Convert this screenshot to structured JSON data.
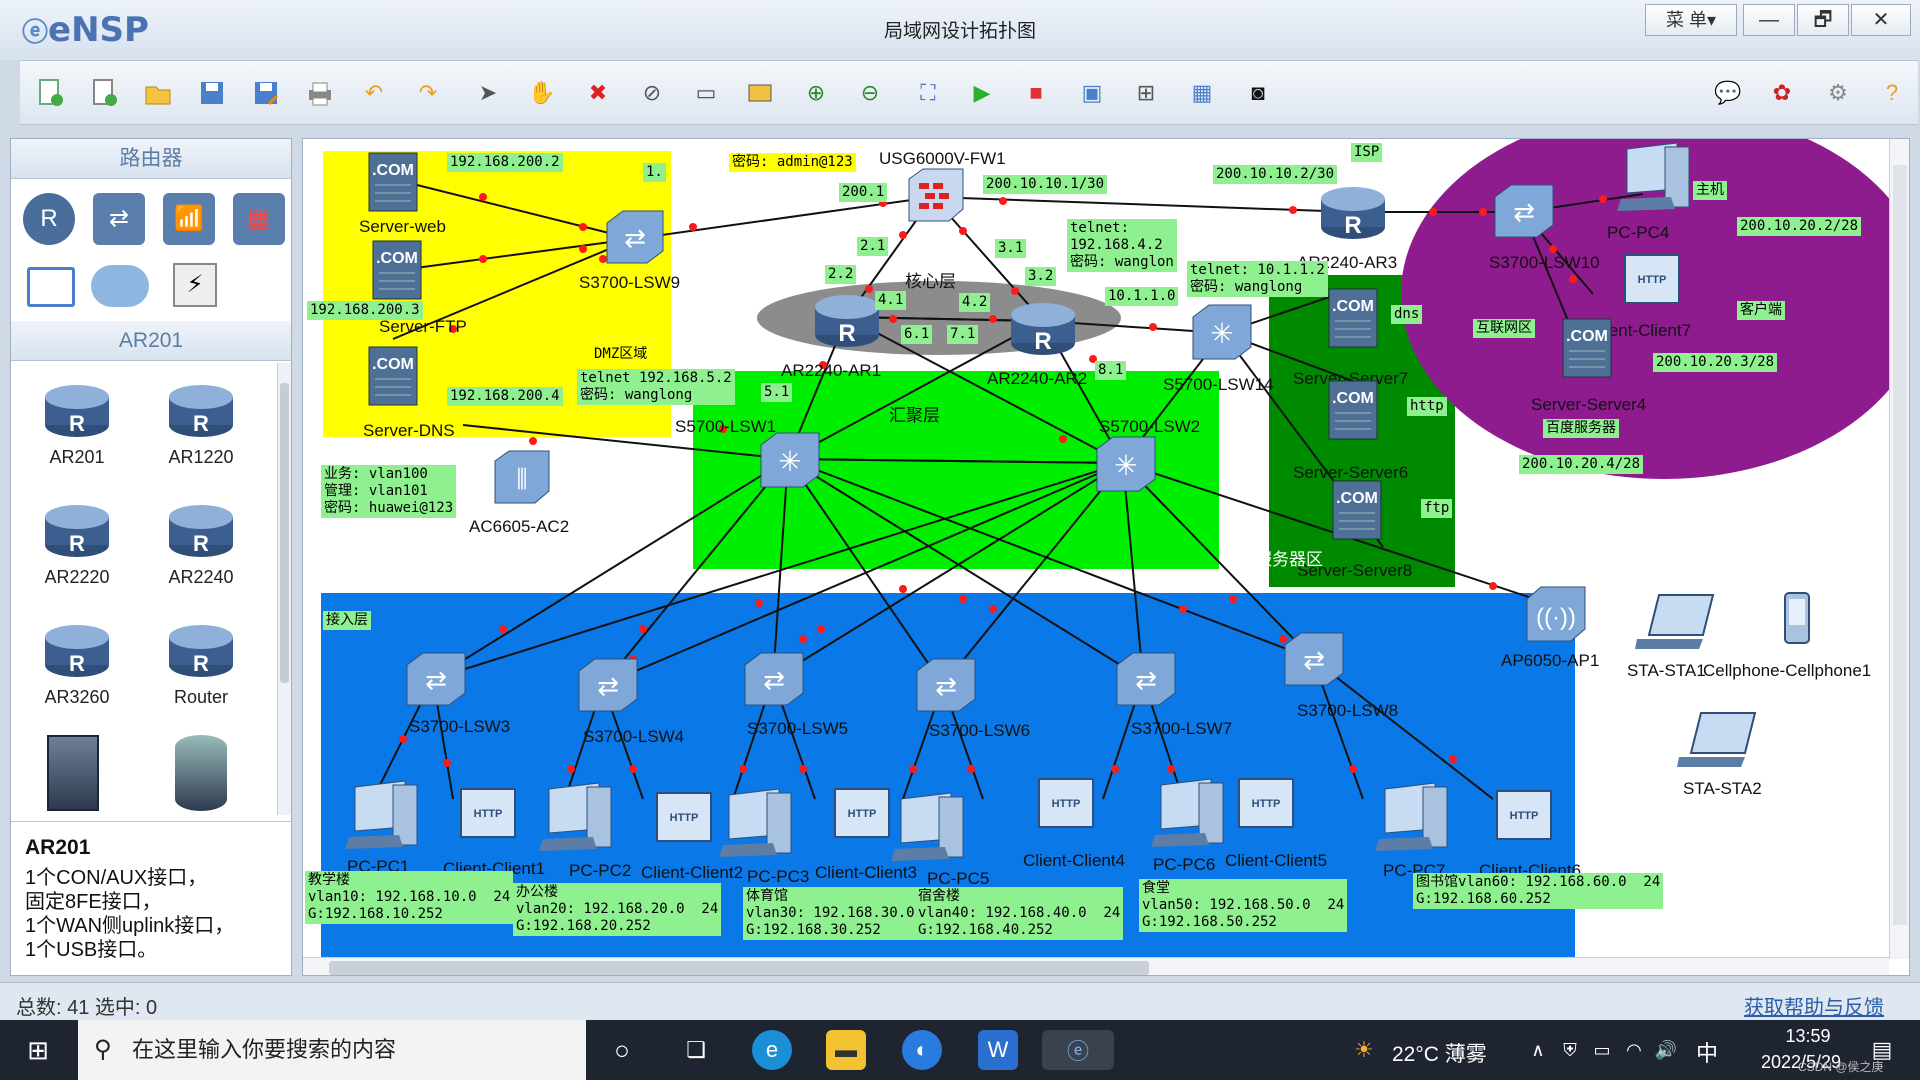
{
  "app": {
    "logo": "eNSP",
    "window_title": "局域网设计拓扑图",
    "menu_label": "菜 单▾",
    "minimize": "—",
    "restore": "🗗",
    "close": "✕"
  },
  "toolbar": {
    "icons": [
      "new-topo-icon",
      "new-sheet-icon",
      "open-icon",
      "save-icon",
      "save-as-icon",
      "print-icon",
      "undo-icon",
      "redo-icon",
      "select-icon",
      "pan-icon",
      "delete-icon",
      "delete-link-icon",
      "text-icon",
      "rect-icon",
      "zoom-in-icon",
      "zoom-out-icon",
      "fit-icon",
      "start-icon",
      "stop-icon",
      "capture-icon",
      "topo-icon",
      "grid-icon",
      "console-icon",
      "chat-icon",
      "huawei-icon",
      "settings-icon",
      "help-icon"
    ]
  },
  "left_panel": {
    "section1": "路由器",
    "section2": "AR201",
    "devices": [
      "AR201",
      "AR1220",
      "AR2220",
      "AR2240",
      "AR3260",
      "Router"
    ],
    "desc_title": "AR201",
    "desc_lines": [
      "1个CON/AUX接口，",
      "固定8FE接口，",
      "1个WAN侧uplink接口，",
      "1个USB接口。"
    ]
  },
  "topology": {
    "zones": {
      "dmz": "DMZ区域",
      "core": "核心层",
      "agg": "汇聚层",
      "server": "服务器区",
      "internet": "互联网区",
      "access": "接入层",
      "isp": "ISP"
    },
    "nodes": {
      "server_web": "Server-web",
      "server_ftp": "Server-FTP",
      "server_dns": "Server-DNS",
      "lsw9": "S3700-LSW9",
      "fw1": "USG6000V-FW1",
      "ar1": "AR2240-AR1",
      "ar2": "AR2240-AR2",
      "ar3": "AR2240-AR3",
      "lsw14": "S5700-LSW14",
      "lsw1": "S5700-LSW1",
      "lsw2": "S5700-LSW2",
      "lsw10": "S3700-LSW10",
      "pc4": "PC-PC4",
      "client7": "Client-Client7",
      "server4": "Server-Server4",
      "server7": "Server-Server7",
      "server6": "Server-Server6",
      "server8": "Server-Server8",
      "ac2": "AC6605-AC2",
      "ap1": "AP6050-AP1",
      "sta1": "STA-STA1",
      "cell1": "Cellphone-Cellphone1",
      "sta2": "STA-STA2",
      "lsw3": "S3700-LSW3",
      "lsw4": "S3700-LSW4",
      "lsw5": "S3700-LSW5",
      "lsw6": "S3700-LSW6",
      "lsw7": "S3700-LSW7",
      "lsw8": "S3700-LSW8",
      "pc1": "PC-PC1",
      "client1": "Client-Client1",
      "pc2": "PC-PC2",
      "client2": "Client-Client2",
      "pc3": "PC-PC3",
      "client3": "Client-Client3",
      "pc5": "PC-PC5",
      "client4": "Client-Client4",
      "pc6": "PC-PC6",
      "client5": "Client-Client5",
      "pc7": "PC-PC7",
      "client6": "Client-Client6"
    },
    "labels": {
      "ip_web": "192.168.200.2",
      "ip_ftp": "192.168.200.3",
      "ip_dns": "192.168.200.4",
      "one": "1.",
      "fw_pwd": "密码: admin@123",
      "fw_200_1": "200.1",
      "fw_wan": "200.10.10.1/30",
      "isp_ip": "200.10.10.2/30",
      "l21": "2.1",
      "l22": "2.2",
      "l31": "3.1",
      "l32": "3.2",
      "l41": "4.1",
      "l42": "4.2",
      "l61": "6.1",
      "l71": "7.1",
      "l81": "8.1",
      "l51": "5.1",
      "telnet1": "telnet:\n192.168.4.2\n密码: wanglon",
      "telnet2": "telnet: 10.1.1.2\n密码: wanglong",
      "l1011": "10.1.1.0",
      "telnet3": "telnet 192.168.5.2\n密码: wanglong",
      "dns": "dns",
      "http": "http",
      "ftp": "ftp",
      "host": "主机",
      "pc4_ip": "200.10.20.2/28",
      "client_lbl": "客户端",
      "client7_ip": "200.10.20.3/28",
      "baidu": "百度服务器",
      "server4_ip": "200.10.20.4/28",
      "ac_info": "业务: vlan100\n管理: vlan101\n密码: huawei@123",
      "b1": "教学楼\nvlan10: 192.168.10.0  24\nG:192.168.10.252",
      "b2": "办公楼\nvlan20: 192.168.20.0  24\nG:192.168.20.252",
      "b3": "体育馆\nvlan30: 192.168.30.0\nG:192.168.30.252",
      "b4": "宿舍楼\nvlan40: 192.168.40.0  24\nG:192.168.40.252",
      "b5": "食堂\nvlan50: 192.168.50.0  24\nG:192.168.50.252",
      "b6": "图书馆vlan60: 192.168.60.0  24\nG:192.168.60.252"
    }
  },
  "status": {
    "total": "总数: 41  选中: 0",
    "help": "获取帮助与反馈"
  },
  "taskbar": {
    "search": "在这里输入你要搜索的内容",
    "weather": "22°C 薄雾",
    "ime": "中",
    "time": "13:59",
    "date": "2022/5/29",
    "watermark": "CSDN @侯之庚"
  }
}
